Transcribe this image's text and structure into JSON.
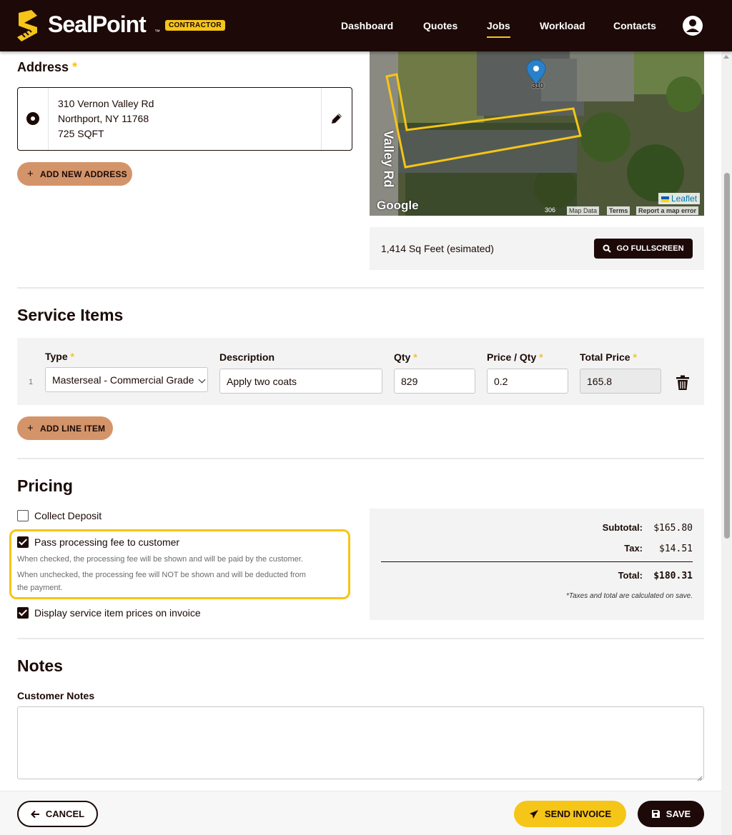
{
  "nav": {
    "brand": "SealPoint",
    "brand_tm": "™",
    "badge": "CONTRACTOR",
    "links": [
      "Dashboard",
      "Quotes",
      "Jobs",
      "Workload",
      "Contacts"
    ],
    "active": "Jobs",
    "accent": "#f5c518",
    "bg": "#1d0907"
  },
  "address": {
    "heading": "Address",
    "required_mark": "*",
    "line1": "310 Vernon Valley Rd",
    "line2": "Northport, NY 11768",
    "line3": "725 SQFT",
    "add_label": "ADD NEW ADDRESS"
  },
  "map": {
    "house_number": "310",
    "road_label": "Valley Rd",
    "road_number": "306",
    "leaflet": "Leaflet",
    "google": "Google",
    "map_data": "Map Data",
    "terms": "Terms",
    "report": "Report a map error",
    "sqft_text": "1,414 Sq Feet (esimated)",
    "fullscreen_label": "GO FULLSCREEN"
  },
  "service_items": {
    "title": "Service Items",
    "columns": {
      "type": "Type",
      "description": "Description",
      "qty": "Qty",
      "price": "Price / Qty",
      "total": "Total Price"
    },
    "rows": [
      {
        "num": "1",
        "type": "Masterseal - Commercial Grade",
        "description": "Apply two coats",
        "qty": "829",
        "price": "0.2",
        "total": "165.8"
      }
    ],
    "add_label": "ADD LINE ITEM"
  },
  "pricing": {
    "title": "Pricing",
    "collect_deposit": "Collect Deposit",
    "collect_deposit_checked": false,
    "pass_fee": "Pass processing fee to customer",
    "pass_fee_checked": true,
    "help_checked": "When checked, the processing fee will be shown and will be paid by the customer.",
    "help_unchecked_1": "When unchecked, the processing fee will NOT be shown and will be deducted from",
    "help_unchecked_2": "the payment.",
    "display_prices": "Display service item prices on invoice",
    "display_prices_checked": true,
    "subtotal_label": "Subtotal:",
    "subtotal": "$165.80",
    "tax_label": "Tax:",
    "tax": "$14.51",
    "total_label": "Total:",
    "total": "$180.31",
    "note": "*Taxes and total are calculated on save."
  },
  "notes": {
    "title": "Notes",
    "customer_notes_label": "Customer Notes",
    "customer_notes_value": ""
  },
  "footer": {
    "cancel": "CANCEL",
    "send_invoice": "SEND INVOICE",
    "save": "SAVE"
  }
}
